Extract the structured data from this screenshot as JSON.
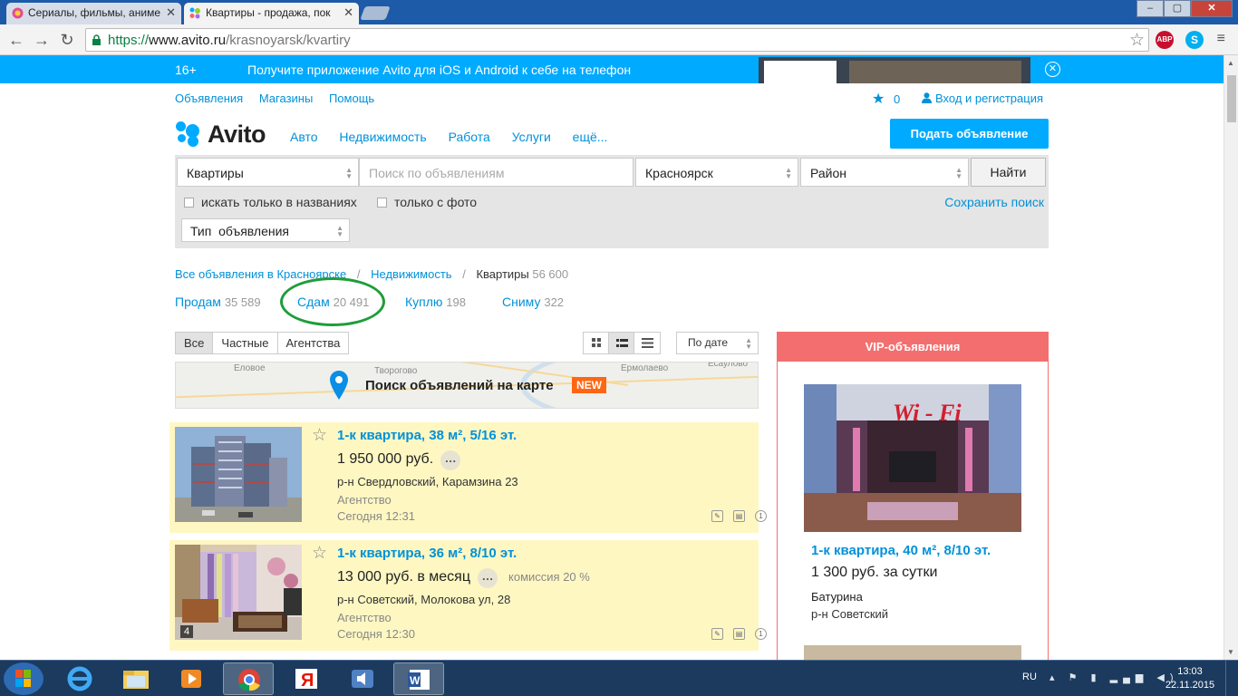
{
  "browser": {
    "tabs": [
      {
        "label": "Сериалы, фильмы, аниме",
        "close": "✕"
      },
      {
        "label": "Квартиры - продажа, пок",
        "close": "✕"
      }
    ],
    "window_buttons": {
      "minimize": "‒",
      "maximize": "▢",
      "close": "✕"
    },
    "url_scheme": "https://",
    "url_host": "www.avito.ru",
    "url_path": "/krasnoyarsk/kvartiry",
    "extensions": [
      "ABP",
      "S"
    ]
  },
  "promo": {
    "age": "16+",
    "text": "Получите приложение Avito для iOS и Android к себе на телефон",
    "close": "✕"
  },
  "topnav": {
    "links": [
      "Объявления",
      "Магазины",
      "Помощь"
    ],
    "favorites_count": "0",
    "login": "Вход и регистрация"
  },
  "header": {
    "logo": "Avito",
    "categories": [
      "Авто",
      "Недвижимость",
      "Работа",
      "Услуги",
      "ещё..."
    ],
    "post_ad": "Подать объявление"
  },
  "search": {
    "category": "Квартиры",
    "query_placeholder": "Поиск по объявлениям",
    "city": "Красноярск",
    "district": "Район",
    "find_button": "Найти",
    "check_titles": "искать только в названиях",
    "check_photo": "только с фото",
    "save_search": "Сохранить поиск",
    "ad_type": "Тип  объявления"
  },
  "breadcrumbs": {
    "all": "Все объявления в Красноярске",
    "realty": "Недвижимость",
    "current": "Квартиры",
    "current_count": "56 600",
    "sep": "/"
  },
  "deal_types": [
    {
      "label": "Продам",
      "count": "35 589"
    },
    {
      "label": "Сдам",
      "count": "20 491"
    },
    {
      "label": "Куплю",
      "count": "198"
    },
    {
      "label": "Сниму",
      "count": "322"
    }
  ],
  "filters": {
    "tabs": [
      "Все",
      "Частные",
      "Агентства"
    ],
    "sort": "По дате"
  },
  "map": {
    "title": "Поиск объявлений на карте",
    "new_badge": "NEW",
    "places": [
      "Еловое",
      "Творогово",
      "Ермолаево",
      "Есаулово"
    ]
  },
  "listings": [
    {
      "title": "1-к квартира, 38 м², 5/16 эт.",
      "price": "1 950 000 руб.",
      "commission": "",
      "address": "р-н Свердловский, Карамзина 23",
      "seller": "Агентство",
      "date": "Сегодня 12:31",
      "photo_count": "",
      "photo_label": "building-photo"
    },
    {
      "title": "1-к квартира, 36 м², 8/10 эт.",
      "price": "13 000 руб. в месяц",
      "commission": "комиссия 20 %",
      "address": "р-н Советский, Молокова ул, 28",
      "seller": "Агентство",
      "date": "Сегодня 12:30",
      "photo_count": "4",
      "photo_label": "room-photo"
    }
  ],
  "vip": {
    "header": "VIP-объявления",
    "photo_text": "Wi - Fi",
    "title": "1-к квартира, 40 м², 8/10 эт.",
    "price": "1 300 руб. за сутки",
    "name": "Батурина",
    "address": "р-н Советский"
  },
  "taskbar": {
    "lang": "RU",
    "time": "13:03",
    "date": "22.11.2015"
  },
  "colors": {
    "avito_blue": "#00aaff",
    "link": "#0091d9",
    "highlight": "#fff7c2",
    "vip_red": "#f36f6f",
    "annotation_green": "#1f9d3a"
  }
}
